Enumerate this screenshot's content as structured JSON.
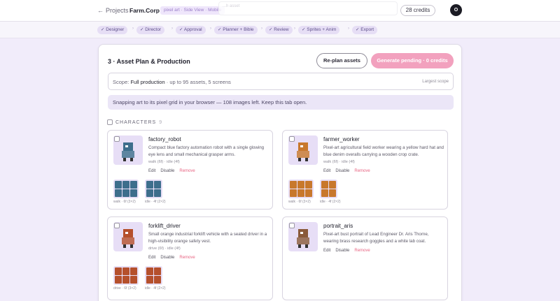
{
  "topbar": {
    "back_label": "Projects",
    "brand": "Farm.Corp",
    "mode": "pixel art · Side View · Mobile",
    "ghost_text": "...h asset",
    "credits": "28 credits",
    "avatar_initial": "O"
  },
  "steps": [
    "Designer",
    "Director",
    "Approval",
    "Planner + Bible",
    "Review",
    "Sprites + Anim",
    "Export"
  ],
  "panel": {
    "title": "3 · Asset Plan & Production",
    "replan_label": "Re-plan assets",
    "generate_label": "Generate pending · 0 credits",
    "scope_label": "Scope:",
    "scope_value": "Full production",
    "scope_detail": "· up to 95 assets, 5 screens",
    "scope_right": "Largest scope",
    "banner": "Snapping art to its pixel grid in your browser — 108 images left. Keep this tab open."
  },
  "characters": {
    "label": "CHARACTERS",
    "count": "9",
    "actions": {
      "edit": "Edit",
      "disable": "Disable",
      "remove": "Remove"
    },
    "items": [
      {
        "name": "factory_robot",
        "desc": "Compact blue factory automation robot with a single glowing eye lens and small mechanical grasper arms.",
        "meta": "walk (6f) · idle (4f)",
        "sprite_color": "#3d6e8c",
        "strips": [
          {
            "caption": "walk · 6f (3×2)",
            "cols": 3,
            "frames": 6
          },
          {
            "caption": "idle · 4f (2×2)",
            "cols": 2,
            "frames": 4
          }
        ]
      },
      {
        "name": "farmer_worker",
        "desc": "Pixel-art agricultural field worker wearing a yellow hard hat and blue denim overalls carrying a wooden crop crate.",
        "meta": "walk (6f) · idle (4f)",
        "sprite_color": "#c8782c",
        "strips": [
          {
            "caption": "walk · 6f (3×2)",
            "cols": 3,
            "frames": 6
          },
          {
            "caption": "idle · 4f (2×2)",
            "cols": 2,
            "frames": 4
          }
        ]
      },
      {
        "name": "forklift_driver",
        "desc": "Small orange industrial forklift vehicle with a seated driver in a high-visibility orange safety vest.",
        "meta": "drive (6f) · idle (4f)",
        "sprite_color": "#b5502c",
        "strips": [
          {
            "caption": "drive · 6f (3×2)",
            "cols": 3,
            "frames": 6
          },
          {
            "caption": "idle · 4f (2×2)",
            "cols": 2,
            "frames": 4
          }
        ]
      },
      {
        "name": "portrait_aris",
        "desc": "Pixel-art bust portrait of Lead Engineer Dr. Aris Thorne, wearing brass research goggles and a white lab coat.",
        "meta": "",
        "sprite_color": "#8a5a3a",
        "strips": []
      }
    ]
  },
  "colors": {
    "accent_pink": "#f2a1be",
    "remove_red": "#e86583",
    "step_bg": "#e6def5",
    "page_bg": "#f1ecfa"
  }
}
